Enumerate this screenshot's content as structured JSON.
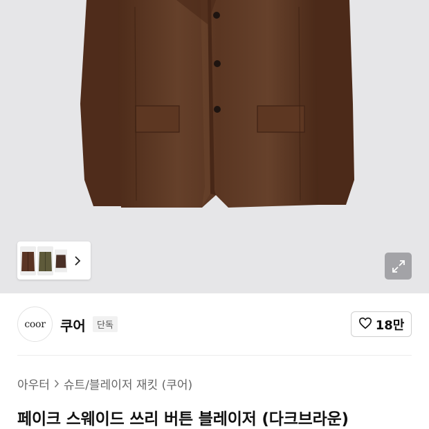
{
  "product": {
    "thumbnails": [
      {
        "icon": "thumbnail-brown-jacket",
        "color": "#5a3424"
      },
      {
        "icon": "thumbnail-olive-jacket",
        "color": "#5e5a3a"
      },
      {
        "icon": "thumbnail-dark-jacket",
        "color": "#4a3026"
      }
    ],
    "more_icon": "chevron-right-icon",
    "expand_icon": "expand-icon"
  },
  "brand": {
    "logo_text": "coor",
    "name": "쿠어",
    "badge": "단독"
  },
  "like": {
    "icon": "heart-outline-icon",
    "count": "18만"
  },
  "breadcrumb": {
    "category": "아우터",
    "subcategory": "슈트/블레이저 재킷 (쿠어)"
  },
  "title": "페이크 스웨이드 쓰리 버튼 블레이저 (다크브라운)",
  "colors": {
    "jacket": "#5a3320",
    "background": "#e6e6e8",
    "text": "#111111",
    "muted": "#666666"
  }
}
